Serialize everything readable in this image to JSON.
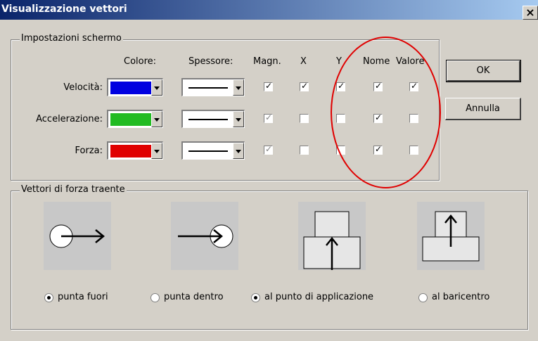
{
  "window": {
    "title": "Visualizzazione vettori",
    "close_glyph": "×"
  },
  "screen_group": {
    "label": "Impostazioni schermo",
    "headers": {
      "colore": "Colore:",
      "spessore": "Spessore:",
      "magn": "Magn.",
      "x": "X",
      "y": "Y",
      "nome": "Nome",
      "valore": "Valore"
    },
    "rows": [
      {
        "label": "Velocità:",
        "color": "#0000e0",
        "magn": true,
        "magn_disabled": false,
        "x": true,
        "y": true,
        "nome": true,
        "valore": true
      },
      {
        "label": "Accelerazione:",
        "color": "#22bb22",
        "magn": true,
        "magn_disabled": true,
        "x": false,
        "y": false,
        "nome": true,
        "valore": false
      },
      {
        "label": "Forza:",
        "color": "#e00000",
        "magn": true,
        "magn_disabled": true,
        "x": false,
        "y": false,
        "nome": true,
        "valore": false
      }
    ]
  },
  "buttons": {
    "ok": "OK",
    "cancel": "Annulla"
  },
  "force_group": {
    "label": "Vettori di forza traente",
    "options": [
      {
        "label": "punta fuori",
        "selected": true,
        "icon": "circle-arrow-out-icon"
      },
      {
        "label": "punta dentro",
        "selected": false,
        "icon": "circle-arrow-in-icon"
      },
      {
        "label": "al punto di applicazione",
        "selected": true,
        "icon": "stacked-blocks-application-icon"
      },
      {
        "label": "al baricentro",
        "selected": false,
        "icon": "stacked-blocks-center-icon"
      }
    ]
  },
  "annotation": {
    "color": "#e00000"
  }
}
